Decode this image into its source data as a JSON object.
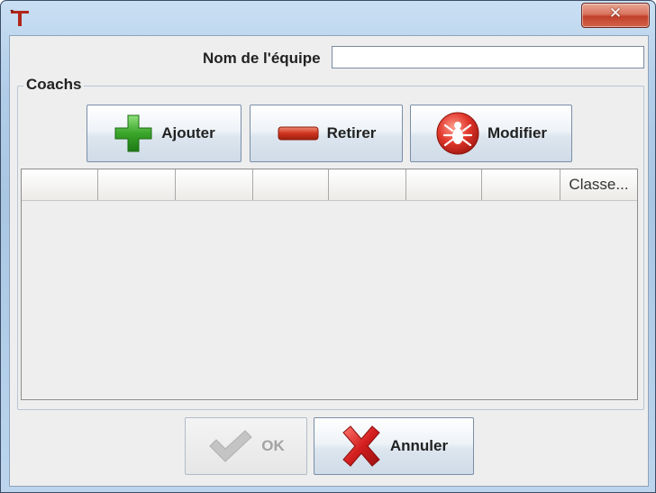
{
  "window": {
    "app_icon_letter": "T",
    "close_icon": "close-icon"
  },
  "form": {
    "team_name_label": "Nom de l'équipe",
    "team_name_value": ""
  },
  "coachs": {
    "group_title": "Coachs",
    "buttons": {
      "add_label": "Ajouter",
      "remove_label": "Retirer",
      "modify_label": "Modifier"
    },
    "table": {
      "columns": [
        "",
        "",
        "",
        "",
        "",
        "",
        "",
        "Classe..."
      ],
      "rows": []
    }
  },
  "footer": {
    "ok_label": "OK",
    "ok_enabled": false,
    "cancel_label": "Annuler"
  },
  "colors": {
    "add_icon": "#3aa52a",
    "remove_icon": "#d0341e",
    "cancel_icon": "#d31f1f",
    "app_icon": "#b0261a"
  }
}
